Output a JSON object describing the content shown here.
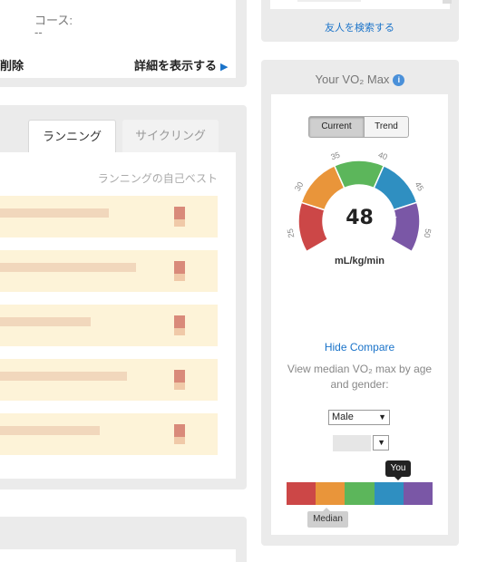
{
  "course_panel": {
    "course_label": "コース:",
    "course_value": "--",
    "delete_label": "削除",
    "detail_label": "詳細を表示する",
    "detail_arrow": "▶"
  },
  "records_panel": {
    "tabs": [
      {
        "label": "ランニング",
        "active": true
      },
      {
        "label": "サイクリング",
        "active": false
      }
    ],
    "personal_best_title": "ランニングの自己ベスト"
  },
  "friends": {
    "search_link": "友人を検索する"
  },
  "vo2": {
    "title": "Your VO₂ Max",
    "info_glyph": "i",
    "toggle_current": "Current",
    "toggle_trend": "Trend",
    "value": "48",
    "unit": "mL/kg/min",
    "gauge_ticks": [
      "25",
      "30",
      "35",
      "40",
      "45",
      "50"
    ],
    "gauge_min": 25,
    "gauge_max": 50,
    "gauge_colors": [
      "#cc4747",
      "#e9953a",
      "#5cb65b",
      "#2f8fc1",
      "#7a57a6"
    ],
    "hide_compare": "Hide Compare",
    "compare_desc": "View median VO₂ max by age and gender:",
    "gender_value": "Male",
    "caret": "▼",
    "you_label": "You",
    "median_label": "Median"
  }
}
